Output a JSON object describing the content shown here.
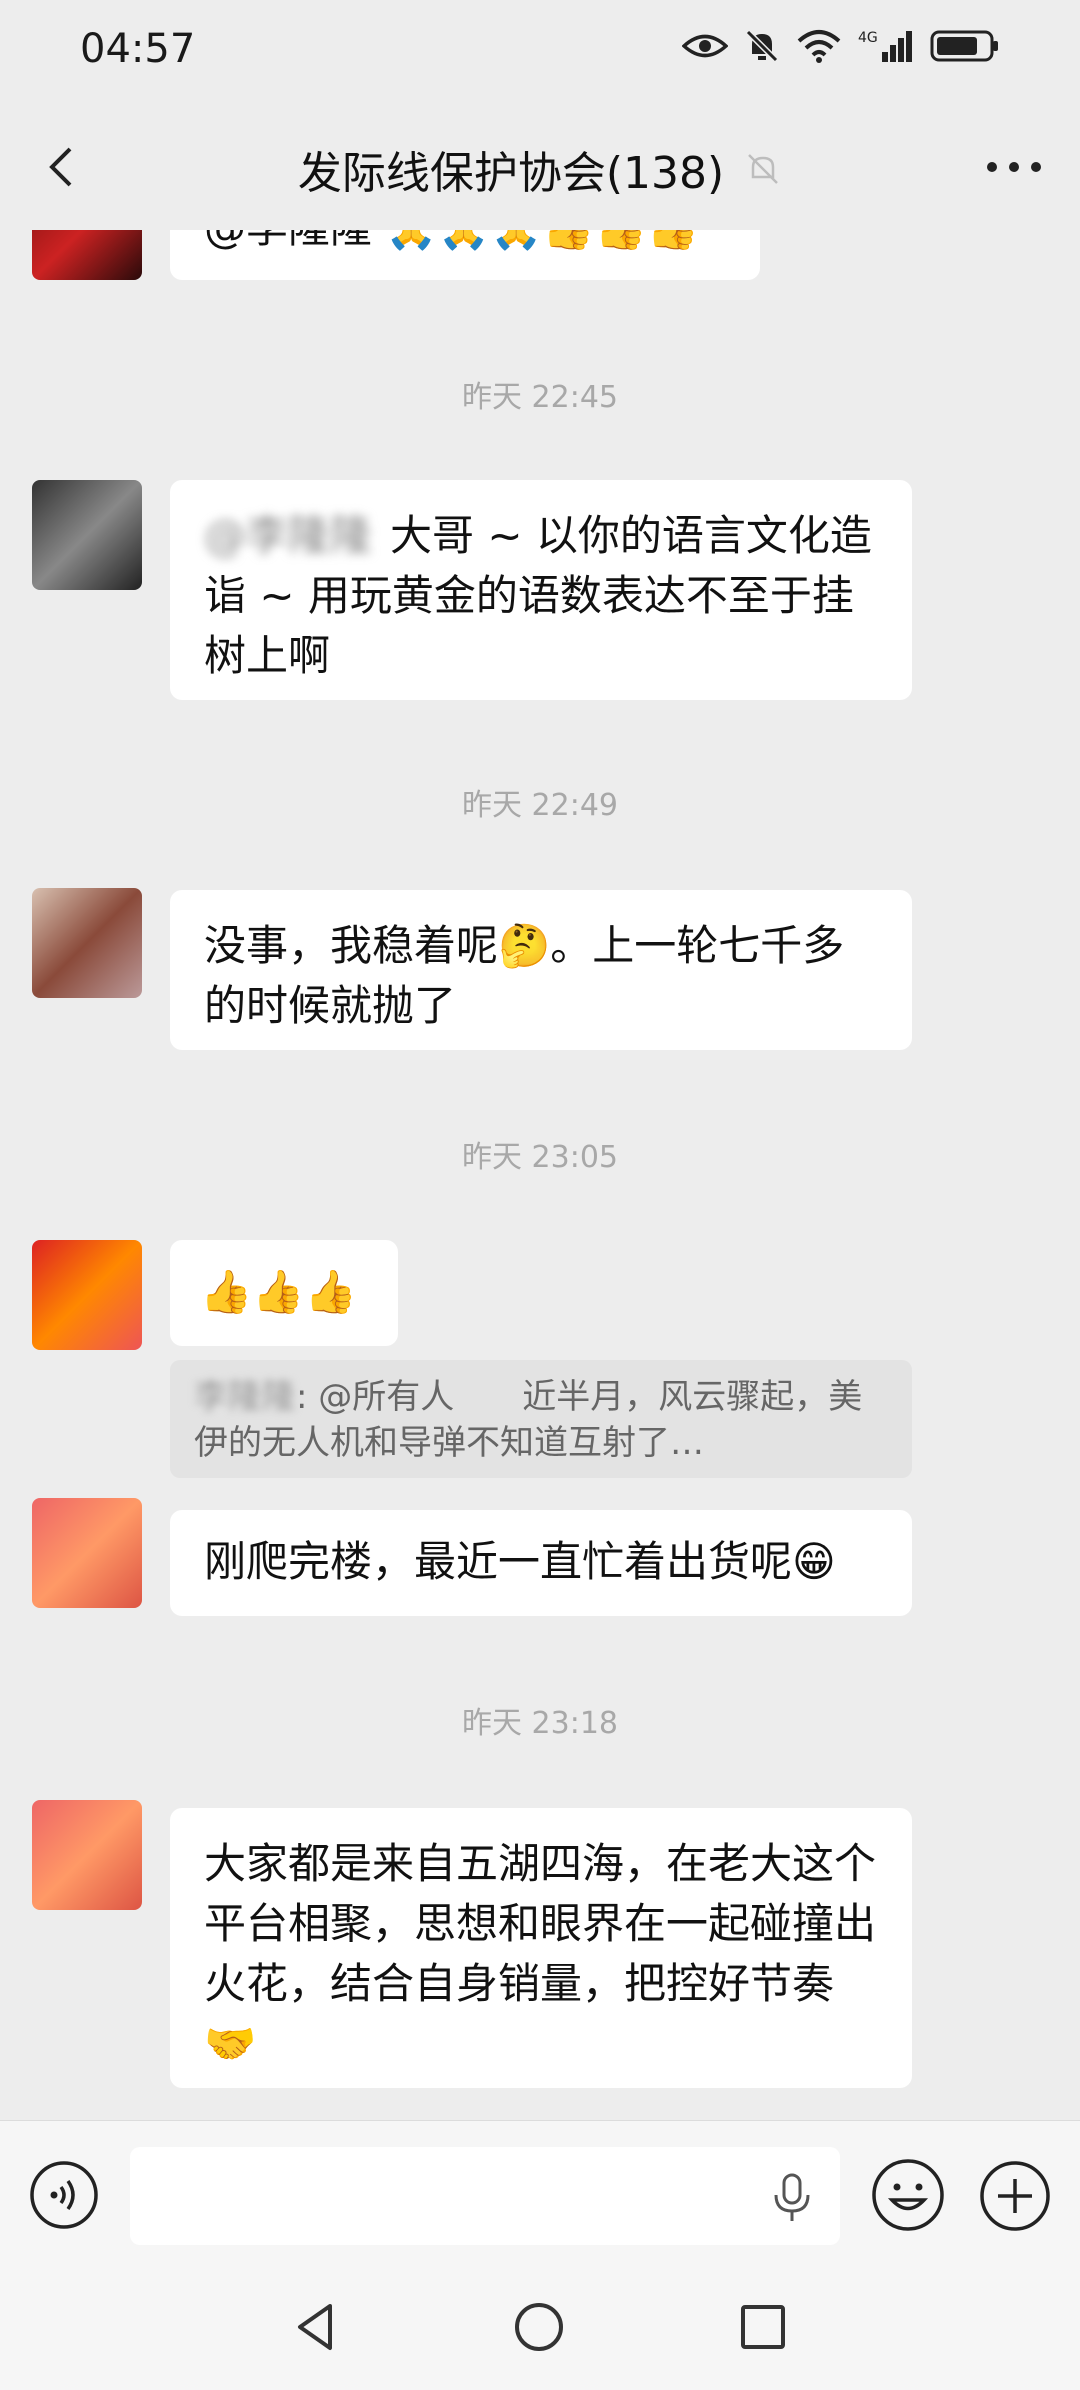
{
  "status_bar": {
    "time": "04:57",
    "network": "4G"
  },
  "header": {
    "title": "发际线保护协会(138)"
  },
  "messages": [
    {
      "type": "partial",
      "text": "@李隆隆",
      "emoji": "🙏🙏🙏👍👍👍"
    },
    {
      "type": "timestamp",
      "text": "昨天 22:45"
    },
    {
      "type": "text",
      "blurred_mention": "@李隆隆",
      "text": "大哥 ~ 以你的语言文化造诣 ~ 用玩黄金的语数表达不至于挂树上啊"
    },
    {
      "type": "timestamp",
      "text": "昨天 22:49"
    },
    {
      "type": "text",
      "text": "没事，我稳着呢🤔。上一轮七千多的时候就抛了"
    },
    {
      "type": "timestamp",
      "text": "昨天 23:05"
    },
    {
      "type": "emoji",
      "text": "👍👍👍"
    },
    {
      "type": "quote",
      "name": "李隆隆",
      "text": ": @所有人　　近半月，风云骤起，美伊的无人机和导弹不知道互射了…"
    },
    {
      "type": "text",
      "text": "刚爬完楼，最近一直忙着出货呢😁"
    },
    {
      "type": "timestamp",
      "text": "昨天 23:18"
    },
    {
      "type": "text",
      "text": "大家都是来自五湖四海，在老大这个平台相聚，思想和眼界在一起碰撞出火花，结合自身销量，把控好节奏🤝"
    }
  ],
  "input": {
    "value": "",
    "placeholder": ""
  },
  "icons": {
    "voice": "voice-icon",
    "mic": "mic-icon",
    "emoji": "emoji-icon",
    "plus": "plus-icon",
    "back": "back-icon",
    "mute": "mute-icon",
    "more": "more-icon"
  },
  "colors": {
    "background": "#ededed",
    "bubble": "#ffffff",
    "timestamp": "#a8a8a8",
    "quote_bg": "#e3e3e3"
  }
}
